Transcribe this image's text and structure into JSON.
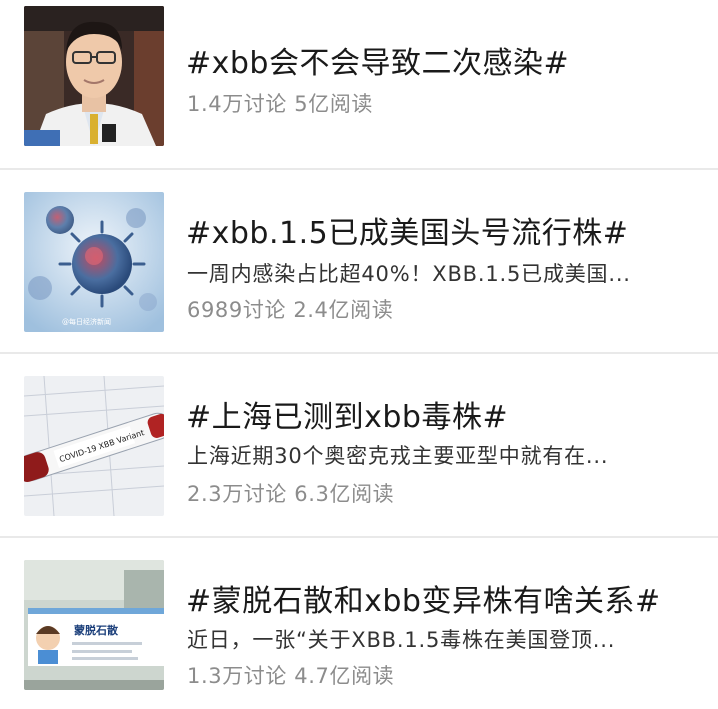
{
  "topics": [
    {
      "title": "#xbb会不会导致二次感染#",
      "stats": "1.4万讨论 5亿阅读",
      "thumb_icon": "doctor-portrait"
    },
    {
      "title": "#xbb.1.5已成美国头号流行株#",
      "summary": "一周内感染占比超40%！XBB.1.5已成美国...",
      "stats": "6989讨论 2.4亿阅读",
      "thumb_icon": "virus-illustration",
      "thumb_watermark": "@每日经济新闻"
    },
    {
      "title": "#上海已测到xbb毒株#",
      "summary": "上海近期30个奥密克戎主要亚型中就有在...",
      "stats": "2.3万讨论 6.3亿阅读",
      "thumb_icon": "test-tube",
      "thumb_tube_text": "COVID-19 XBB Variant"
    },
    {
      "title": "#蒙脱石散和xbb变异株有啥关系#",
      "summary": "近日，一张“关于XBB.1.5毒株在美国登顶...",
      "stats": "1.3万讨论 4.7亿阅读",
      "thumb_icon": "medicine-box",
      "thumb_box_text": "蒙脱石散"
    }
  ],
  "colors": {
    "title": "#1a1a1a",
    "summary": "#333333",
    "stats": "#8c8c8c",
    "divider": "#e9e9e9"
  }
}
